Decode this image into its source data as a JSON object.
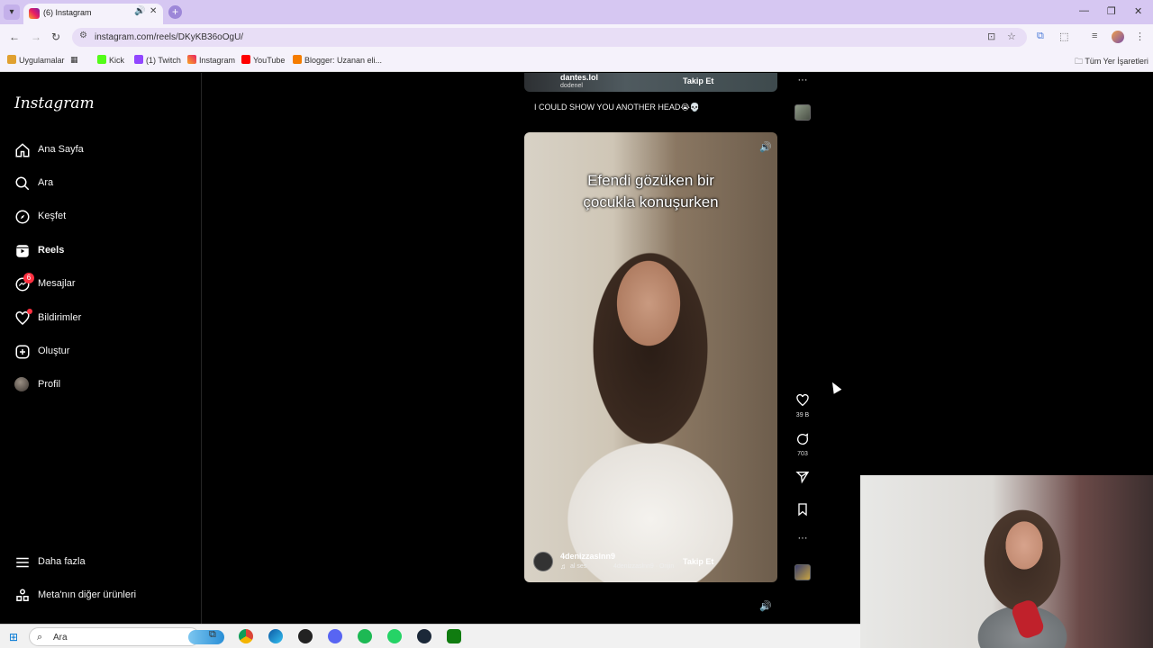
{
  "browser": {
    "tab_title": "(6) Instagram",
    "url": "instagram.com/reels/DKyKB36oOgU/",
    "bookmarks": [
      "Uygulamalar",
      "Kick",
      "(1) Twitch",
      "Instagram",
      "YouTube",
      "Blogger: Uzanan eli..."
    ],
    "all_bookmarks": "Tüm Yer İşaretleri"
  },
  "sidebar": {
    "logo": "Instagram",
    "items": [
      {
        "label": "Ana Sayfa"
      },
      {
        "label": "Ara"
      },
      {
        "label": "Keşfet"
      },
      {
        "label": "Reels"
      },
      {
        "label": "Mesajlar",
        "badge": "6"
      },
      {
        "label": "Bildirimler"
      },
      {
        "label": "Oluştur"
      },
      {
        "label": "Profil"
      }
    ],
    "more": "Daha fazla",
    "meta": "Meta'nın diğer ürünleri"
  },
  "previous_reel": {
    "username": "dantes.lol",
    "subtitle": "dodenel",
    "follow": "Takip Et",
    "caption": "I COULD SHOW YOU ANOTHER HEAD😭💀"
  },
  "current_reel": {
    "overlay_line1": "Efendi gözüken bir",
    "overlay_line2": "çocukla konuşurken",
    "username": "4denizzaslnn9",
    "audio_label": "al ses",
    "audio_track": "4denizzaslnn9 · Orijin",
    "follow": "Takip Et",
    "likes": "39 B",
    "comments": "703"
  },
  "taskbar": {
    "search_placeholder": "Ara"
  },
  "colors": {
    "chrome_accent": "#d6c7f2",
    "instagram_badge": "#ff3040"
  }
}
